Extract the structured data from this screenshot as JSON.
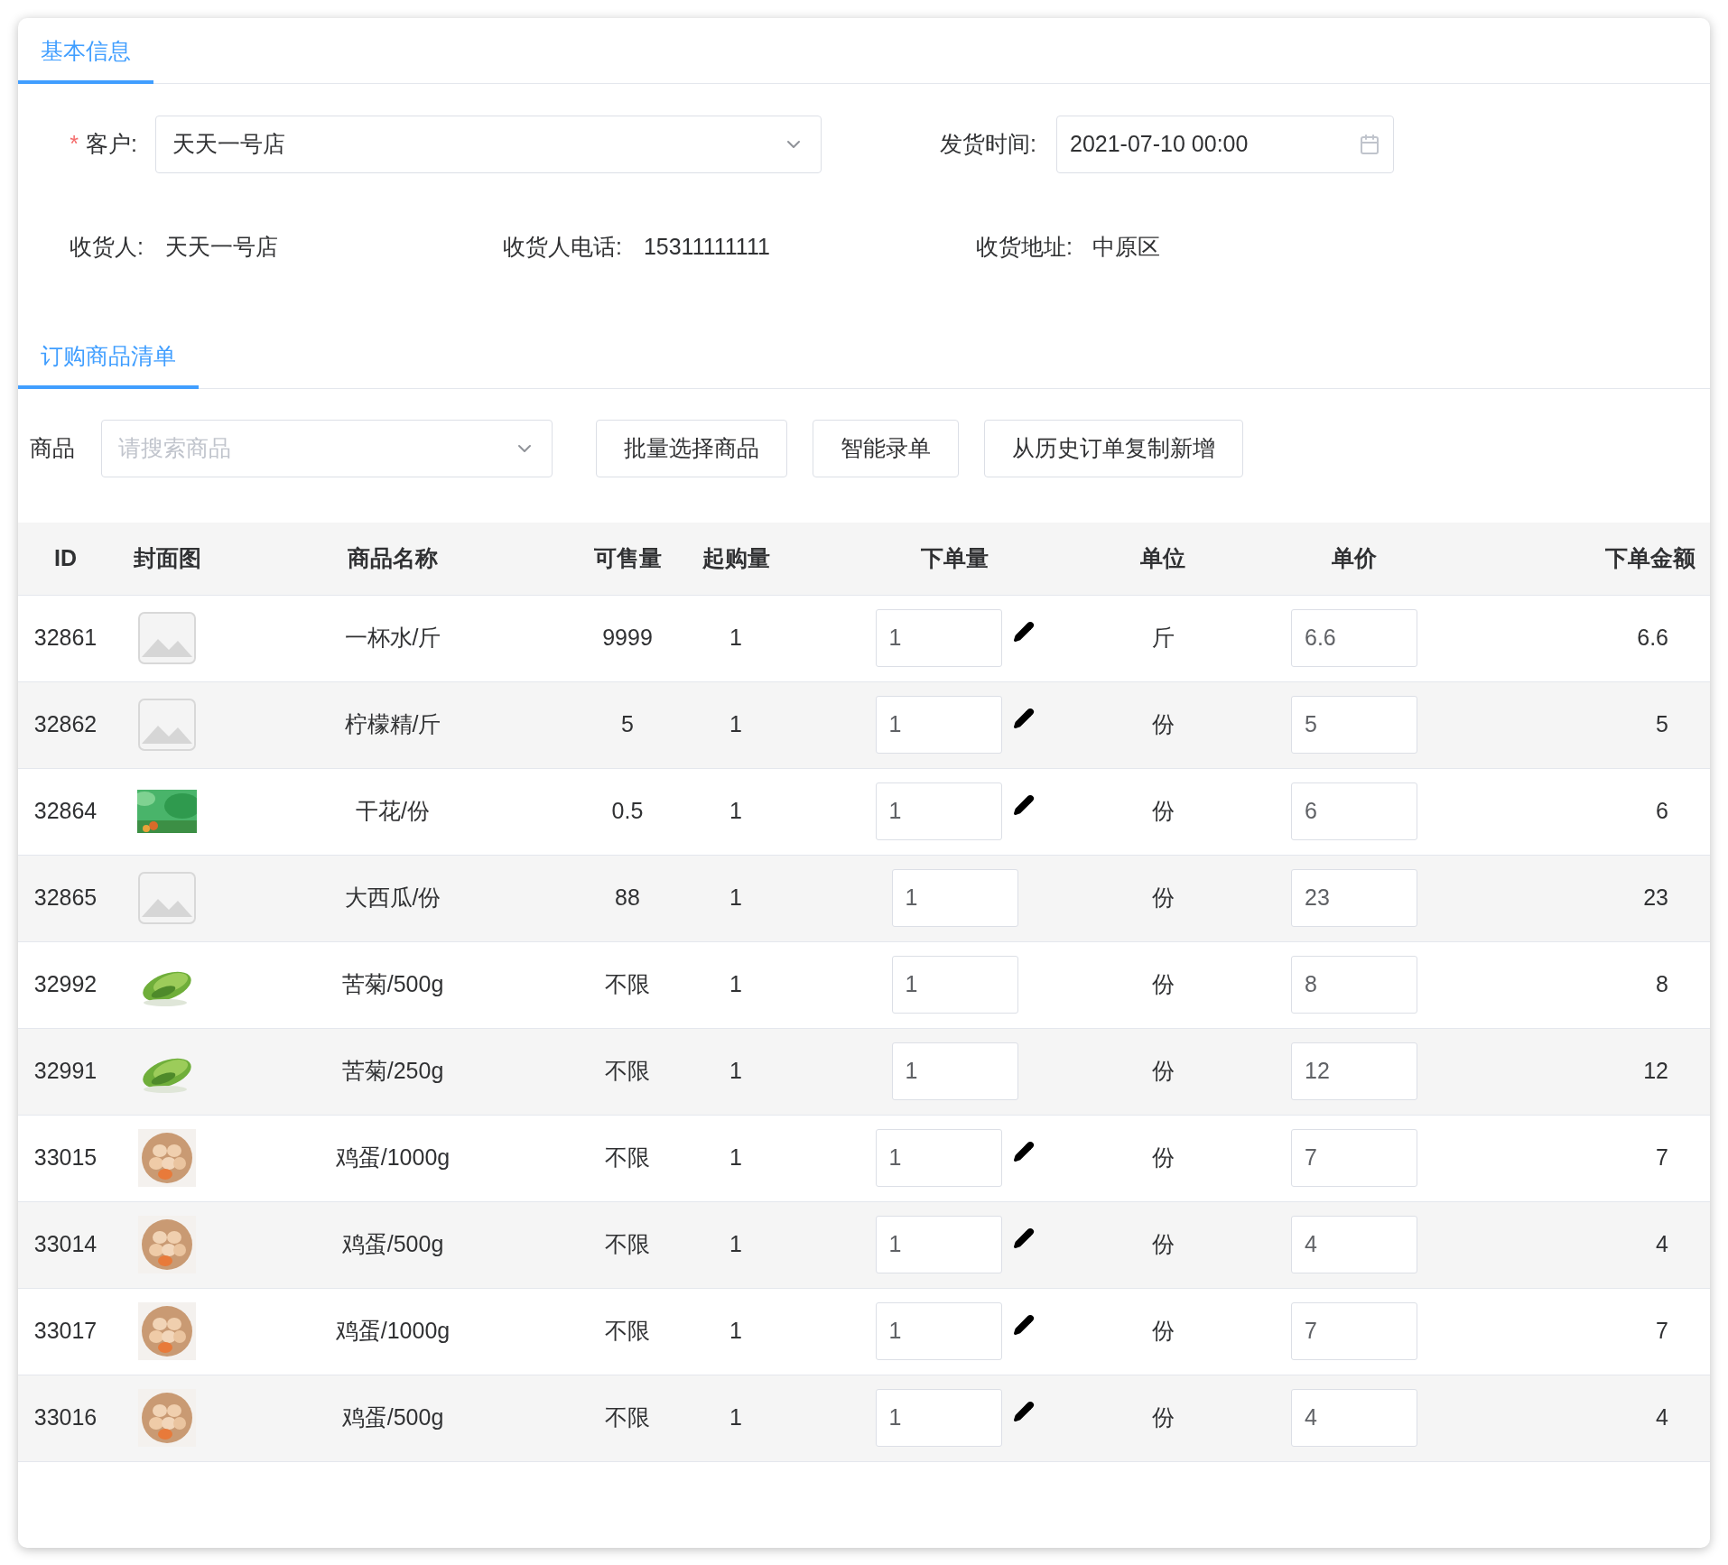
{
  "tabs": [
    {
      "label": "基本信息",
      "selected": true
    }
  ],
  "form": {
    "customer": {
      "label": "客户:",
      "required_mark": "*",
      "value": "天天一号店"
    },
    "ship_time": {
      "label": "发货时间:",
      "value": "2021-07-10 00:00"
    },
    "receiver": {
      "label": "收货人:",
      "value": "天天一号店"
    },
    "phone": {
      "label": "收货人电话:",
      "value": "15311111111"
    },
    "address": {
      "label": "收货地址:",
      "value": "中原区"
    }
  },
  "list_tabs": [
    {
      "label": "订购商品清单",
      "selected": true
    }
  ],
  "toolbar": {
    "label": "商品",
    "search_placeholder": "请搜索商品",
    "buttons": [
      "批量选择商品",
      "智能录单",
      "从历史订单复制新增"
    ]
  },
  "table": {
    "columns": [
      "ID",
      "封面图",
      "商品名称",
      "可售量",
      "起购量",
      "下单量",
      "单位",
      "单价",
      "下单金额"
    ],
    "rows": [
      {
        "id": "32861",
        "kind": "placeholder",
        "name": "一杯水/斤",
        "stock": "9999",
        "min": "1",
        "qty": "1",
        "editable": true,
        "unit": "斤",
        "price": "6.6",
        "amount": "6.6"
      },
      {
        "id": "32862",
        "kind": "placeholder",
        "name": "柠檬精/斤",
        "stock": "5",
        "min": "1",
        "qty": "1",
        "editable": true,
        "unit": "份",
        "price": "5",
        "amount": "5"
      },
      {
        "id": "32864",
        "kind": "banner",
        "name": "干花/份",
        "stock": "0.5",
        "min": "1",
        "qty": "1",
        "editable": true,
        "unit": "份",
        "price": "6",
        "amount": "6"
      },
      {
        "id": "32865",
        "kind": "placeholder",
        "name": "大西瓜/份",
        "stock": "88",
        "min": "1",
        "qty": "1",
        "editable": false,
        "unit": "份",
        "price": "23",
        "amount": "23"
      },
      {
        "id": "32992",
        "kind": "greens",
        "name": "苦菊/500g",
        "stock": "不限",
        "min": "1",
        "qty": "1",
        "editable": false,
        "unit": "份",
        "price": "8",
        "amount": "8"
      },
      {
        "id": "32991",
        "kind": "greens",
        "name": "苦菊/250g",
        "stock": "不限",
        "min": "1",
        "qty": "1",
        "editable": false,
        "unit": "份",
        "price": "12",
        "amount": "12"
      },
      {
        "id": "33015",
        "kind": "eggs",
        "name": "鸡蛋/1000g",
        "stock": "不限",
        "min": "1",
        "qty": "1",
        "editable": true,
        "unit": "份",
        "price": "7",
        "amount": "7"
      },
      {
        "id": "33014",
        "kind": "eggs",
        "name": "鸡蛋/500g",
        "stock": "不限",
        "min": "1",
        "qty": "1",
        "editable": true,
        "unit": "份",
        "price": "4",
        "amount": "4"
      },
      {
        "id": "33017",
        "kind": "eggs",
        "name": "鸡蛋/1000g",
        "stock": "不限",
        "min": "1",
        "qty": "1",
        "editable": true,
        "unit": "份",
        "price": "7",
        "amount": "7"
      },
      {
        "id": "33016",
        "kind": "eggs",
        "name": "鸡蛋/500g",
        "stock": "不限",
        "min": "1",
        "qty": "1",
        "editable": true,
        "unit": "份",
        "price": "4",
        "amount": "4"
      }
    ]
  }
}
